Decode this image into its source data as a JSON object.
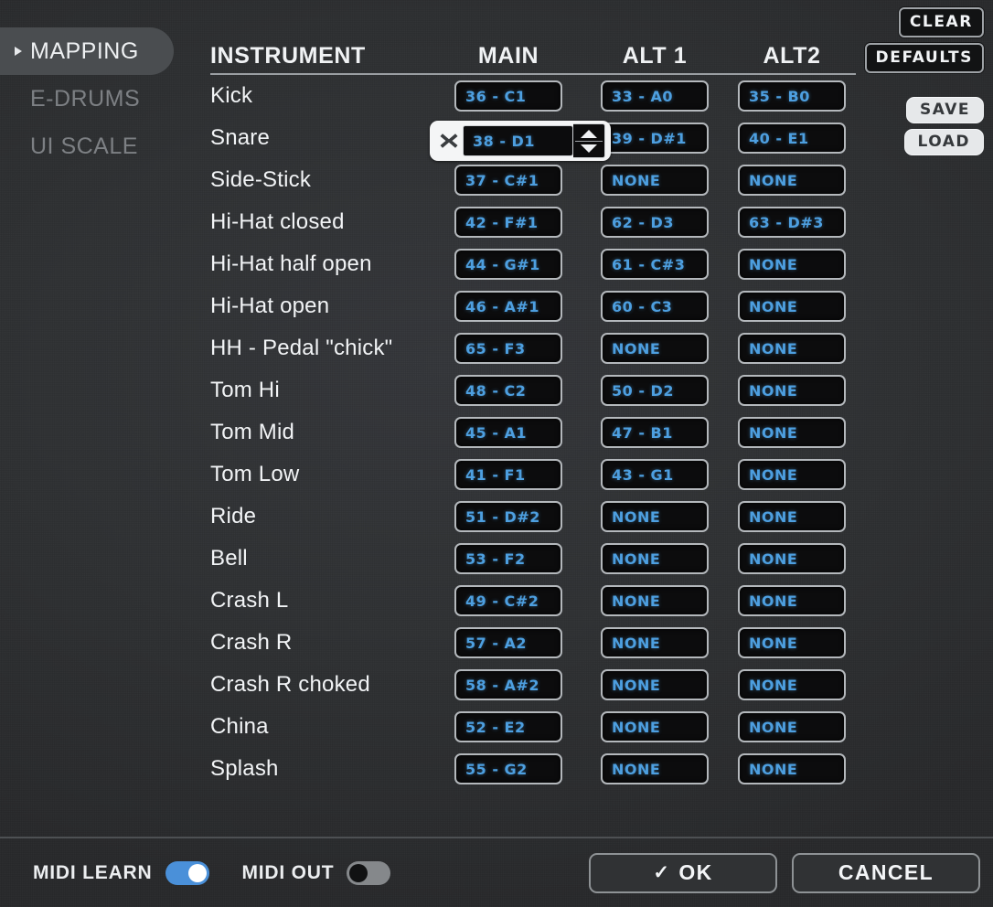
{
  "sidebar": {
    "items": [
      {
        "label": "MAPPING",
        "active": true
      },
      {
        "label": "E-DRUMS",
        "active": false
      },
      {
        "label": "UI SCALE",
        "active": false
      }
    ]
  },
  "toolbar": {
    "clear_label": "CLEAR",
    "defaults_label": "DEFAULTS",
    "save_label": "SAVE",
    "load_label": "LOAD"
  },
  "table": {
    "headers": {
      "instrument": "INSTRUMENT",
      "main": "MAIN",
      "alt1": "ALT 1",
      "alt2": "ALT2"
    },
    "rows": [
      {
        "instrument": "Kick",
        "main": "36 - C1",
        "alt1": "33 - A0",
        "alt2": "35 - B0",
        "editing": false
      },
      {
        "instrument": "Snare",
        "main": "38 - D1",
        "alt1": "39 - D#1",
        "alt2": "40 - E1",
        "editing": true
      },
      {
        "instrument": "Side-Stick",
        "main": "37 - C#1",
        "alt1": "NONE",
        "alt2": "NONE",
        "editing": false
      },
      {
        "instrument": "Hi-Hat closed",
        "main": "42 - F#1",
        "alt1": "62 - D3",
        "alt2": "63 - D#3",
        "editing": false
      },
      {
        "instrument": "Hi-Hat half open",
        "main": "44 - G#1",
        "alt1": "61 - C#3",
        "alt2": "NONE",
        "editing": false
      },
      {
        "instrument": "Hi-Hat open",
        "main": "46 - A#1",
        "alt1": "60 - C3",
        "alt2": "NONE",
        "editing": false
      },
      {
        "instrument": "HH - Pedal \"chick\"",
        "main": "65 - F3",
        "alt1": "NONE",
        "alt2": "NONE",
        "editing": false
      },
      {
        "instrument": "Tom Hi",
        "main": "48 - C2",
        "alt1": "50 - D2",
        "alt2": "NONE",
        "editing": false
      },
      {
        "instrument": "Tom Mid",
        "main": "45 - A1",
        "alt1": "47 - B1",
        "alt2": "NONE",
        "editing": false
      },
      {
        "instrument": "Tom Low",
        "main": "41 - F1",
        "alt1": "43 - G1",
        "alt2": "NONE",
        "editing": false
      },
      {
        "instrument": "Ride",
        "main": "51 - D#2",
        "alt1": "NONE",
        "alt2": "NONE",
        "editing": false
      },
      {
        "instrument": "Bell",
        "main": "53 - F2",
        "alt1": "NONE",
        "alt2": "NONE",
        "editing": false
      },
      {
        "instrument": "Crash L",
        "main": "49 - C#2",
        "alt1": "NONE",
        "alt2": "NONE",
        "editing": false
      },
      {
        "instrument": "Crash R",
        "main": "57 - A2",
        "alt1": "NONE",
        "alt2": "NONE",
        "editing": false
      },
      {
        "instrument": "Crash R choked",
        "main": "58 - A#2",
        "alt1": "NONE",
        "alt2": "NONE",
        "editing": false
      },
      {
        "instrument": "China",
        "main": "52 - E2",
        "alt1": "NONE",
        "alt2": "NONE",
        "editing": false
      },
      {
        "instrument": "Splash",
        "main": "55 - G2",
        "alt1": "NONE",
        "alt2": "NONE",
        "editing": false
      }
    ]
  },
  "footer": {
    "midi_learn_label": "MIDI LEARN",
    "midi_learn_on": true,
    "midi_out_label": "MIDI OUT",
    "midi_out_on": false,
    "ok_label": "OK",
    "ok_check": "✓",
    "cancel_label": "CANCEL"
  },
  "colors": {
    "accent_blue": "#4d9fe0",
    "toggle_on": "#4a90d9",
    "panel_bg": "#2f3133",
    "chip_bg": "#0c0c0d",
    "text_light": "#f2f4f6",
    "text_dim": "#7d8084"
  }
}
